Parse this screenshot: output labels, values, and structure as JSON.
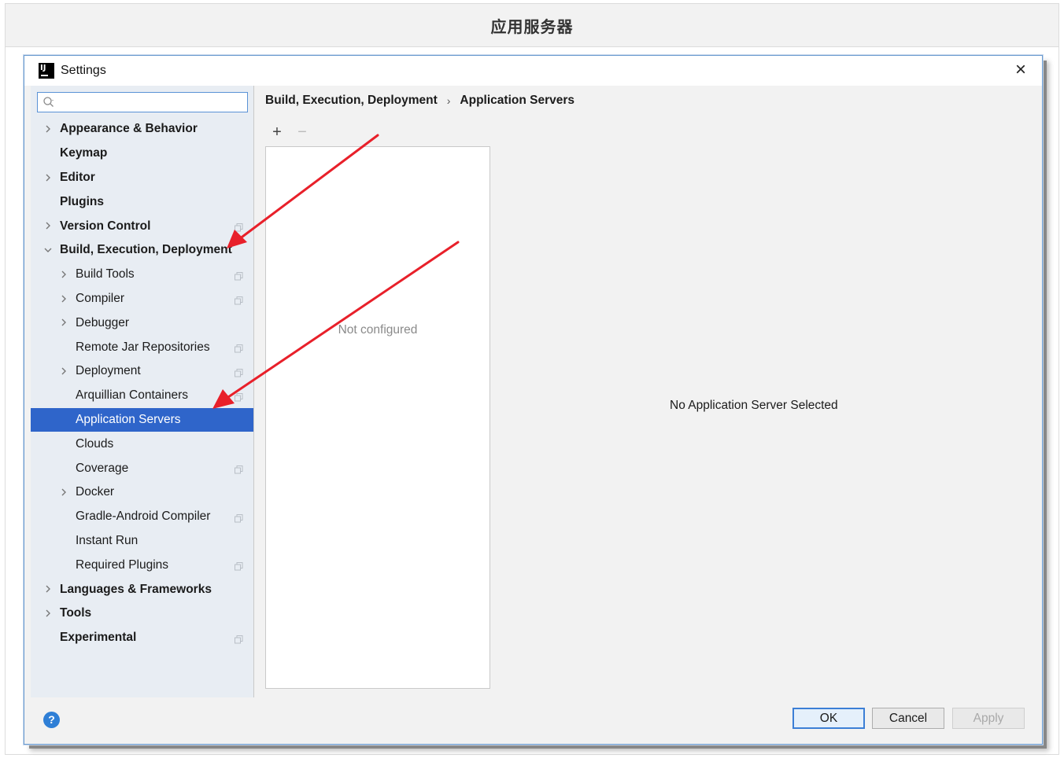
{
  "caption": "应用服务器",
  "window": {
    "title": "Settings",
    "close_label": "×"
  },
  "search": {
    "placeholder": ""
  },
  "tree": {
    "items": [
      {
        "label": "Appearance & Behavior",
        "level": 0,
        "bold": true,
        "expandable": true,
        "expanded": false,
        "copy_icon": false,
        "selected": false
      },
      {
        "label": "Keymap",
        "level": 0,
        "bold": true,
        "expandable": false,
        "expanded": false,
        "copy_icon": false,
        "selected": false
      },
      {
        "label": "Editor",
        "level": 0,
        "bold": true,
        "expandable": true,
        "expanded": false,
        "copy_icon": false,
        "selected": false
      },
      {
        "label": "Plugins",
        "level": 0,
        "bold": true,
        "expandable": false,
        "expanded": false,
        "copy_icon": false,
        "selected": false
      },
      {
        "label": "Version Control",
        "level": 0,
        "bold": true,
        "expandable": true,
        "expanded": false,
        "copy_icon": true,
        "selected": false
      },
      {
        "label": "Build, Execution, Deployment",
        "level": 0,
        "bold": true,
        "expandable": true,
        "expanded": true,
        "copy_icon": false,
        "selected": false
      },
      {
        "label": "Build Tools",
        "level": 1,
        "bold": false,
        "expandable": true,
        "expanded": false,
        "copy_icon": true,
        "selected": false
      },
      {
        "label": "Compiler",
        "level": 1,
        "bold": false,
        "expandable": true,
        "expanded": false,
        "copy_icon": true,
        "selected": false
      },
      {
        "label": "Debugger",
        "level": 1,
        "bold": false,
        "expandable": true,
        "expanded": false,
        "copy_icon": false,
        "selected": false
      },
      {
        "label": "Remote Jar Repositories",
        "level": 1,
        "bold": false,
        "expandable": false,
        "expanded": false,
        "copy_icon": true,
        "selected": false
      },
      {
        "label": "Deployment",
        "level": 1,
        "bold": false,
        "expandable": true,
        "expanded": false,
        "copy_icon": true,
        "selected": false
      },
      {
        "label": "Arquillian Containers",
        "level": 1,
        "bold": false,
        "expandable": false,
        "expanded": false,
        "copy_icon": true,
        "selected": false
      },
      {
        "label": "Application Servers",
        "level": 1,
        "bold": false,
        "expandable": false,
        "expanded": false,
        "copy_icon": false,
        "selected": true
      },
      {
        "label": "Clouds",
        "level": 1,
        "bold": false,
        "expandable": false,
        "expanded": false,
        "copy_icon": false,
        "selected": false
      },
      {
        "label": "Coverage",
        "level": 1,
        "bold": false,
        "expandable": false,
        "expanded": false,
        "copy_icon": true,
        "selected": false
      },
      {
        "label": "Docker",
        "level": 1,
        "bold": false,
        "expandable": true,
        "expanded": false,
        "copy_icon": false,
        "selected": false
      },
      {
        "label": "Gradle-Android Compiler",
        "level": 1,
        "bold": false,
        "expandable": false,
        "expanded": false,
        "copy_icon": true,
        "selected": false
      },
      {
        "label": "Instant Run",
        "level": 1,
        "bold": false,
        "expandable": false,
        "expanded": false,
        "copy_icon": false,
        "selected": false
      },
      {
        "label": "Required Plugins",
        "level": 1,
        "bold": false,
        "expandable": false,
        "expanded": false,
        "copy_icon": true,
        "selected": false
      },
      {
        "label": "Languages & Frameworks",
        "level": 0,
        "bold": true,
        "expandable": true,
        "expanded": false,
        "copy_icon": false,
        "selected": false
      },
      {
        "label": "Tools",
        "level": 0,
        "bold": true,
        "expandable": true,
        "expanded": false,
        "copy_icon": false,
        "selected": false
      },
      {
        "label": "Experimental",
        "level": 0,
        "bold": true,
        "expandable": false,
        "expanded": false,
        "copy_icon": true,
        "selected": false
      }
    ]
  },
  "breadcrumb": {
    "parent": "Build, Execution, Deployment",
    "separator": "›",
    "current": "Application Servers"
  },
  "toolbar": {
    "add_label": "+",
    "remove_label": "−"
  },
  "server_list": {
    "empty_text": "Not configured"
  },
  "details": {
    "empty_text": "No Application Server Selected"
  },
  "buttons": {
    "help": "?",
    "ok": "OK",
    "cancel": "Cancel",
    "apply": "Apply"
  },
  "colors": {
    "selection": "#2f65ca",
    "annotation_arrow": "#e8202a",
    "help": "#2f7fd6"
  }
}
